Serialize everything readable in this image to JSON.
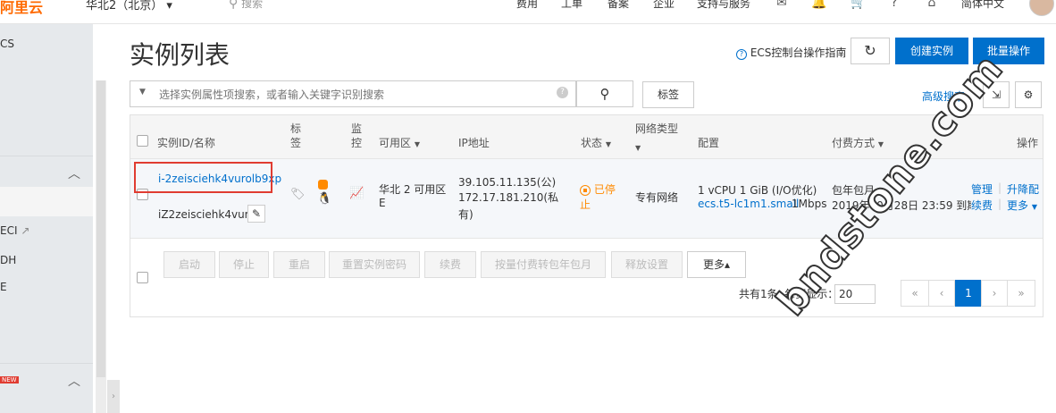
{
  "topbar": {
    "logo": "阿里云",
    "region": "华北2（北京）",
    "region_caret": "▾",
    "search_placeholder": "搜索",
    "nav": [
      "费用",
      "工单",
      "备案",
      "企业",
      "支持与服务"
    ],
    "language": "简体中文"
  },
  "sidebar": {
    "item_ecs": "CS",
    "item_eci": "ECI",
    "item_dh": "DH",
    "item_misc": "E",
    "new_badge": "NEW"
  },
  "header": {
    "title": "实例列表",
    "guide": "ECS控制台操作指南",
    "refresh_icon": "↻",
    "create_button": "创建实例",
    "batch_button": "批量操作"
  },
  "search": {
    "placeholder": "选择实例属性项搜索，或者输入关键字识别搜索",
    "tag_button": "标签",
    "advanced": "高级搜索"
  },
  "table": {
    "headers": {
      "id_name": "实例ID/名称",
      "tag": "标签",
      "monitor": "监控",
      "zone": "可用区",
      "ip": "IP地址",
      "status": "状态",
      "network": "网络类型",
      "config": "配置",
      "billing": "付费方式",
      "actions": "操作"
    },
    "rows": [
      {
        "instance_id": "i-2zeisciehk4vurolb9xp",
        "instance_name": "iZ2zeisciehk4vur...",
        "zone_line1": "华北 2 可用区",
        "zone_line2": "E",
        "ip_public": "39.105.11.135(公)",
        "ip_private_line1": "172.17.181.210(私",
        "ip_private_line2": "有)",
        "status_line1": "已停",
        "status_line2": "止",
        "network": "专有网络",
        "config_line1": "1 vCPU 1 GiB (I/O优化)",
        "config_type": "ecs.t5-lc1m1.small",
        "bandwidth": "1Mbps",
        "billing_line1": "包年包月",
        "billing_line2": "2019年10月28日 23:59 到期",
        "action_manage": "管理",
        "action_upgrade": "升降配",
        "action_renew": "续费",
        "action_more": "更多"
      }
    ]
  },
  "bulk_actions": [
    "启动",
    "停止",
    "重启",
    "重置实例密码",
    "续费",
    "按量付费转包年包月",
    "释放设置"
  ],
  "bulk_more": "更多▴",
  "pagination": {
    "summary": "共有1条, 每页显示：",
    "page_size": "20",
    "first": "«",
    "prev": "‹",
    "current": "1",
    "next": "›",
    "last": "»"
  },
  "watermark": "bndstone.com"
}
